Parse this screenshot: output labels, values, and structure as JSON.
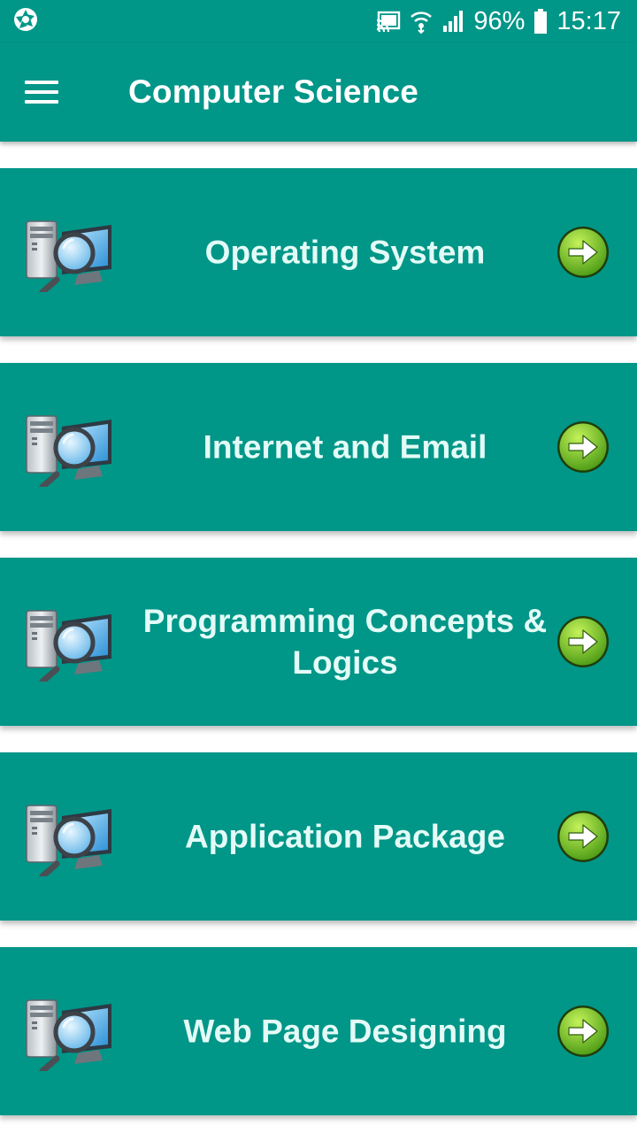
{
  "status_bar": {
    "battery": "96%",
    "time": "15:17",
    "icons": [
      "camera-shutter-icon",
      "cast-icon",
      "wifi-icon",
      "signal-icon",
      "battery-icon"
    ]
  },
  "app_bar": {
    "title": "Computer Science",
    "menu_icon": "hamburger-menu-icon"
  },
  "topics": [
    {
      "label": "Operating System",
      "icon": "computer-search-icon",
      "action_icon": "arrow-right-icon"
    },
    {
      "label": "Internet and Email",
      "icon": "computer-search-icon",
      "action_icon": "arrow-right-icon"
    },
    {
      "label": "Programming Concepts & Logics",
      "icon": "computer-search-icon",
      "action_icon": "arrow-right-icon"
    },
    {
      "label": "Application Package",
      "icon": "computer-search-icon",
      "action_icon": "arrow-right-icon"
    },
    {
      "label": "Web Page Designing",
      "icon": "computer-search-icon",
      "action_icon": "arrow-right-icon"
    }
  ],
  "colors": {
    "primary": "#009688",
    "card_text": "#e3fbf6",
    "arrow_green": "#7dc832"
  }
}
